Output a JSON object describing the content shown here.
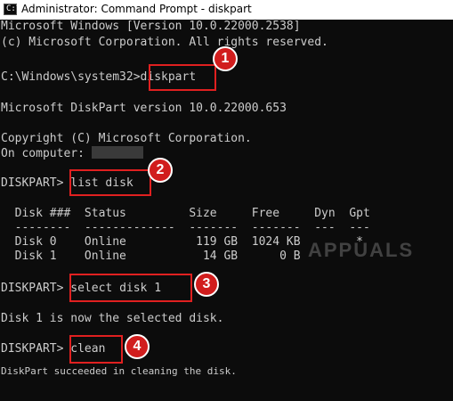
{
  "window": {
    "title": "Administrator: Command Prompt - diskpart",
    "icon_glyph": "C:\\"
  },
  "console": {
    "line1": "Microsoft Windows [Version 10.0.22000.2538]",
    "line2": "(c) Microsoft Corporation. All rights reserved.",
    "prompt1": "C:\\Windows\\system32>",
    "cmd1": "diskpart",
    "line4": "Microsoft DiskPart version 10.0.22000.653",
    "line5": "Copyright (C) Microsoft Corporation.",
    "line6": "On computer: ",
    "prompt2": "DISKPART> ",
    "cmd2": "list disk",
    "table_header": "  Disk ###  Status         Size     Free     Dyn  Gpt",
    "table_rule": "  --------  -------------  -------  -------  ---  ---",
    "table_row1": "  Disk 0    Online          119 GB  1024 KB        *",
    "table_row2": "  Disk 1    Online           14 GB      0 B",
    "prompt3": "DISKPART> ",
    "cmd3": "select disk 1",
    "line_selected": "Disk 1 is now the selected disk.",
    "prompt4": "DISKPART> ",
    "cmd4": "clean",
    "line_cleaned": "DiskPart succeeded in cleaning the disk."
  },
  "annotations": {
    "step1": "1",
    "step2": "2",
    "step3": "3",
    "step4": "4"
  },
  "watermark": "APPUALS",
  "colors": {
    "background": "#0c0c0c",
    "text": "#cccccc",
    "highlight": "#e02020",
    "badge": "#d11d1d"
  }
}
